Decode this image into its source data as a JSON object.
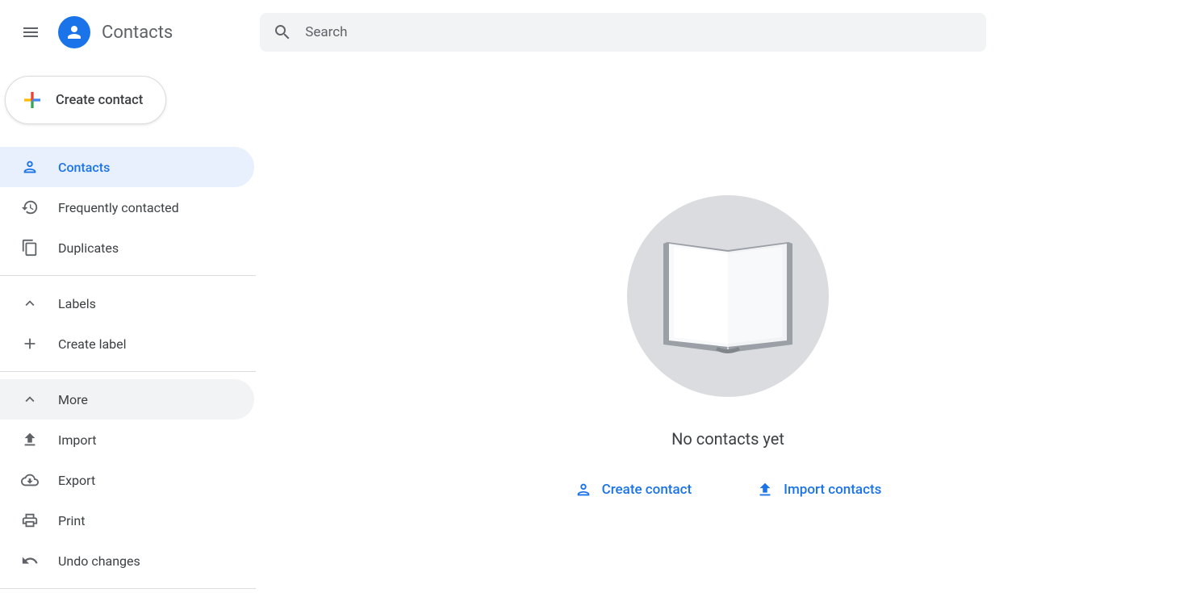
{
  "header": {
    "app_title": "Contacts",
    "search_placeholder": "Search"
  },
  "sidebar": {
    "create_button": "Create contact",
    "nav_primary": {
      "contacts": "Contacts",
      "frequently": "Frequently contacted",
      "duplicates": "Duplicates"
    },
    "labels_section": {
      "header": "Labels",
      "create_label": "Create label"
    },
    "more_section": {
      "header": "More",
      "import": "Import",
      "export": "Export",
      "print": "Print",
      "undo": "Undo changes"
    }
  },
  "main": {
    "empty_title": "No contacts yet",
    "create_contact_action": "Create contact",
    "import_contacts_action": "Import contacts"
  },
  "colors": {
    "accent": "#1a73e8",
    "active_bg": "#e8f0fe",
    "muted": "#5f6368"
  }
}
